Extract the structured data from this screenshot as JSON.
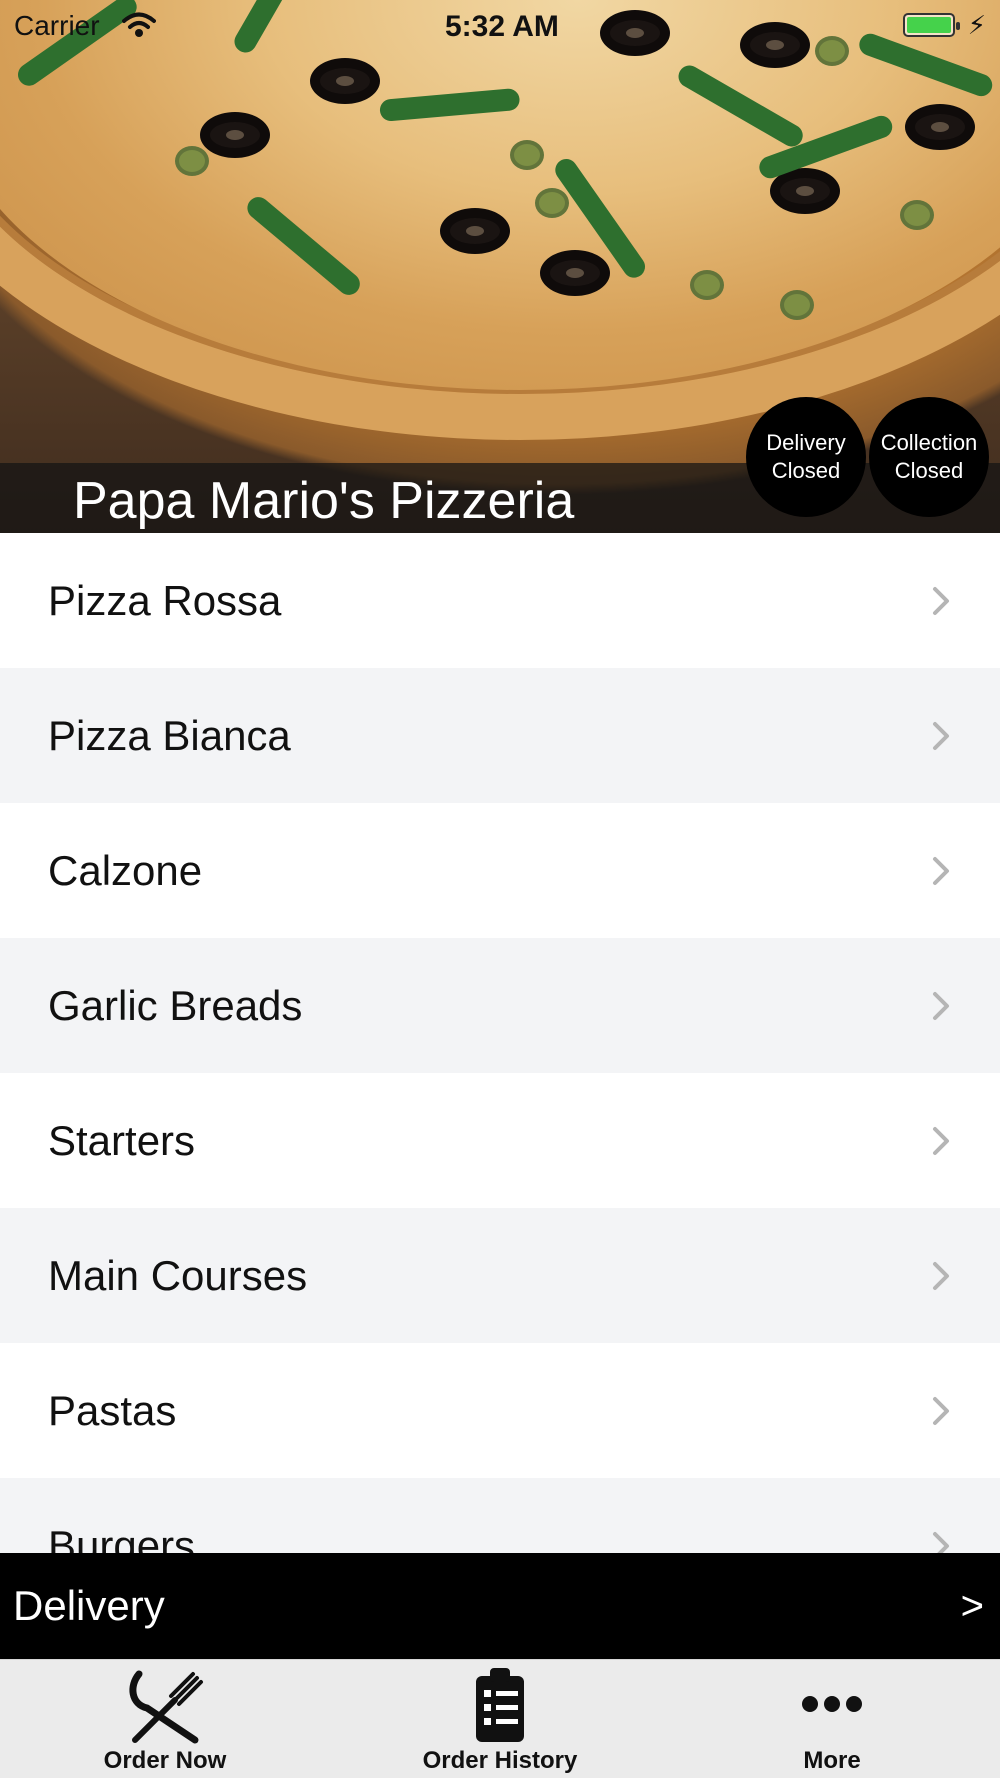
{
  "status_bar": {
    "carrier": "Carrier",
    "time": "5:32 AM"
  },
  "restaurant": {
    "name": "Papa Mario's Pizzeria"
  },
  "status_badges": {
    "delivery": {
      "line1": "Delivery",
      "line2": "Closed"
    },
    "collection": {
      "line1": "Collection",
      "line2": "Closed"
    }
  },
  "categories": [
    {
      "label": "Pizza Rossa"
    },
    {
      "label": "Pizza Bianca"
    },
    {
      "label": "Calzone"
    },
    {
      "label": "Garlic Breads"
    },
    {
      "label": "Starters"
    },
    {
      "label": "Main Courses"
    },
    {
      "label": "Pastas"
    },
    {
      "label": "Burgers"
    }
  ],
  "order_type_bar": {
    "label": "Delivery",
    "arrow": ">"
  },
  "tab_bar": {
    "tabs": [
      {
        "label": "Order Now",
        "icon": "fork-knife-icon"
      },
      {
        "label": "Order History",
        "icon": "clipboard-icon"
      },
      {
        "label": "More",
        "icon": "more-dots-icon"
      }
    ]
  },
  "colors": {
    "list_alt_row": "#f3f4f6",
    "bar_black": "#000000",
    "tabbar_bg": "#ebebeb",
    "battery_green": "#45d24b"
  }
}
